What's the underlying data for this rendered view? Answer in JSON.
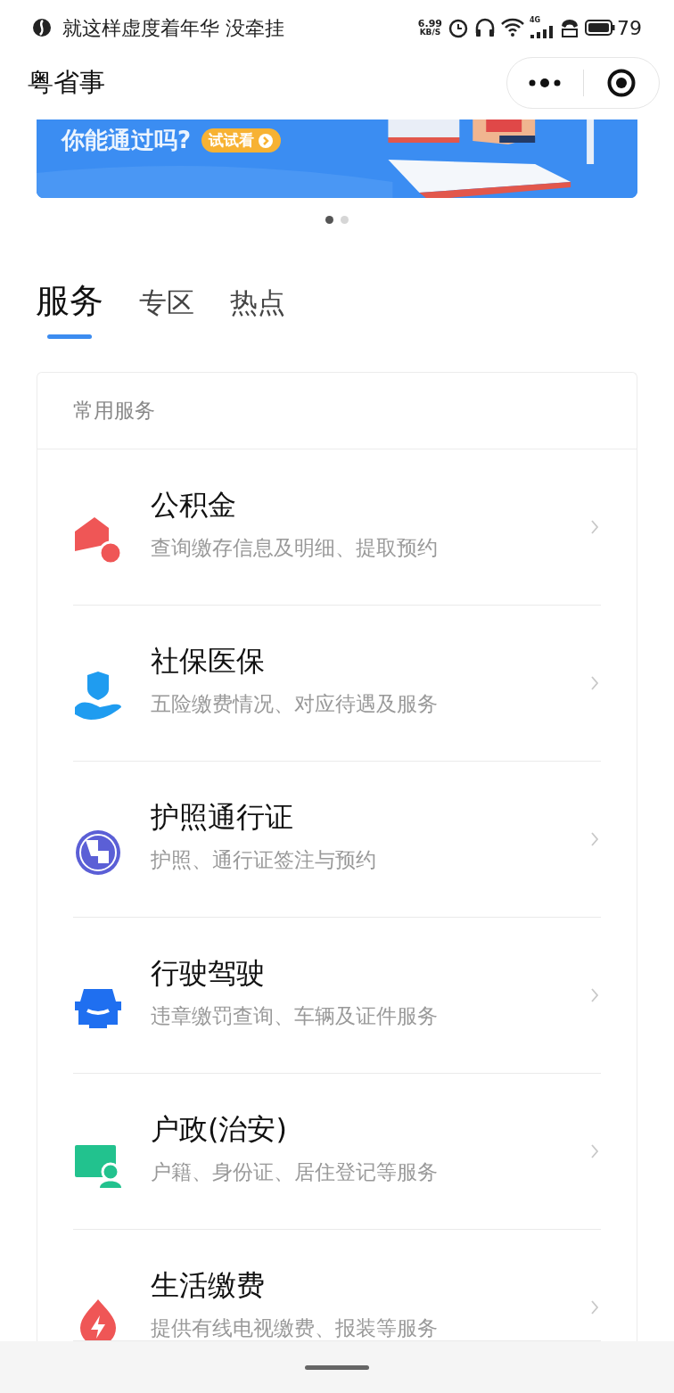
{
  "status_bar": {
    "song": "就这样虚度着年华 没牵挂",
    "speed_value": "6.99",
    "speed_unit": "KB/S",
    "network": "4G",
    "battery": "79"
  },
  "title_bar": {
    "title": "粤省事"
  },
  "banner": {
    "kind": "picture",
    "headline": "你能通过吗?",
    "button": "试试看"
  },
  "carousel_dots": [
    {
      "selected": true
    },
    {
      "selected": false
    }
  ],
  "tabs": [
    {
      "label": "服务",
      "selected": true
    },
    {
      "label": "专区",
      "selected": false
    },
    {
      "label": "热点",
      "selected": false
    }
  ],
  "services": {
    "header": "常用服务",
    "items": [
      {
        "title": "公积金",
        "subtitle": "查询缴存信息及明细、提取预约"
      },
      {
        "title": "社保医保",
        "subtitle": "五险缴费情况、对应待遇及服务"
      },
      {
        "title": "护照通行证",
        "subtitle": "护照、通行证签注与预约"
      },
      {
        "title": "行驶驾驶",
        "subtitle": "违章缴罚查询、车辆及证件服务"
      },
      {
        "title": "户政(治安)",
        "subtitle": "户籍、身份证、居住登记等服务"
      },
      {
        "title": "生活缴费",
        "subtitle": "提供有线电视缴费、报装等服务"
      }
    ]
  }
}
